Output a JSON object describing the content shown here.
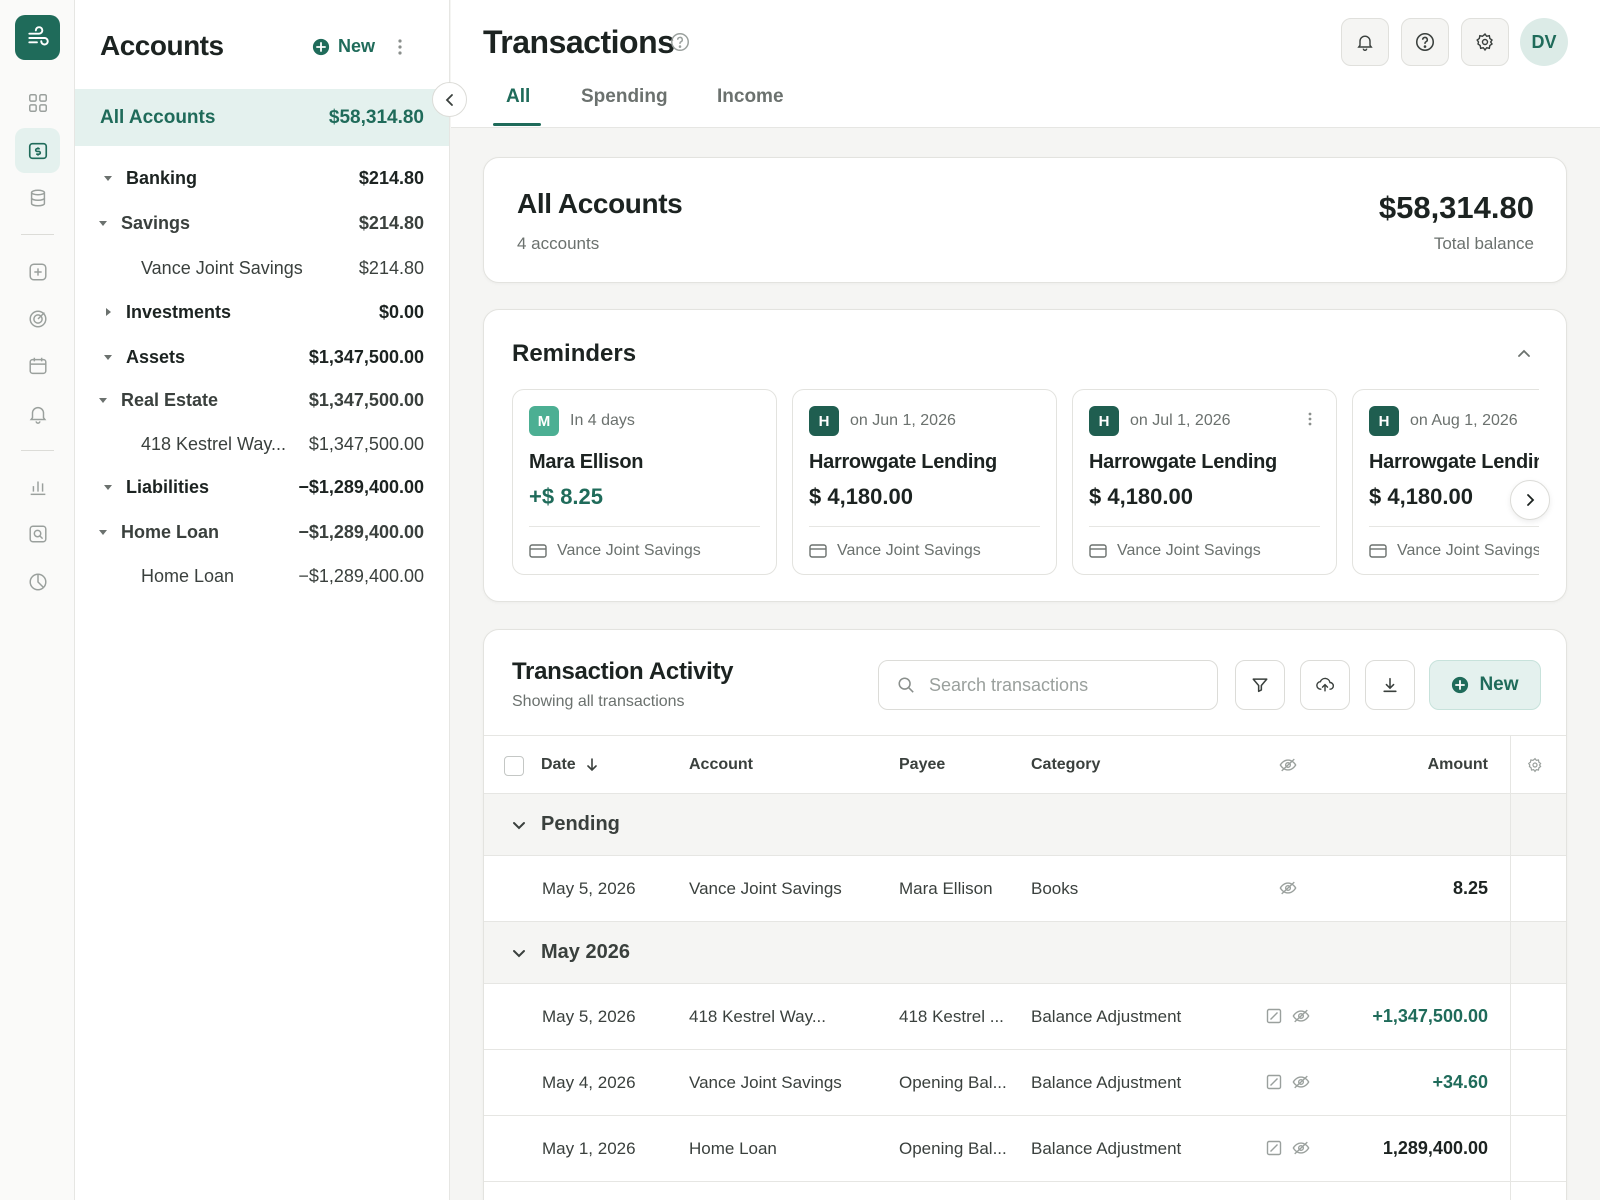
{
  "colors": {
    "accent": "#1f6b5a",
    "accent_light": "#e4f1ee",
    "badge_m": "#4caf93",
    "badge_h": "#1f5e50"
  },
  "rail": {
    "icons": [
      "logo-icon",
      "dashboard-icon",
      "transactions-icon",
      "database-icon",
      "add-icon",
      "target-icon",
      "calendar-icon",
      "bell-icon",
      "bar-chart-icon",
      "receipt-search-icon",
      "pie-chart-icon"
    ]
  },
  "accounts": {
    "title": "Accounts",
    "new_label": "New",
    "all": {
      "label": "All Accounts",
      "value": "$58,314.80"
    },
    "tree": [
      {
        "name": "Banking",
        "value": "$214.80"
      },
      {
        "name": "Savings",
        "value": "$214.80"
      },
      {
        "name": "Vance Joint Savings",
        "value": "$214.80"
      },
      {
        "name": "Investments",
        "value": "$0.00"
      },
      {
        "name": "Assets",
        "value": "$1,347,500.00"
      },
      {
        "name": "Real Estate",
        "value": "$1,347,500.00"
      },
      {
        "name": "418 Kestrel Way...",
        "value": "$1,347,500.00"
      },
      {
        "name": "Liabilities",
        "value": "−$1,289,400.00"
      },
      {
        "name": "Home Loan",
        "value": "−$1,289,400.00"
      },
      {
        "name": "Home Loan",
        "value": "−$1,289,400.00"
      }
    ]
  },
  "header": {
    "title": "Transactions",
    "avatar": "DV",
    "tabs": [
      {
        "label": "All"
      },
      {
        "label": "Spending"
      },
      {
        "label": "Income"
      }
    ]
  },
  "summary": {
    "title": "All Accounts",
    "subtitle": "4 accounts",
    "balance": "$58,314.80",
    "balance_label": "Total balance"
  },
  "reminders": {
    "title": "Reminders",
    "cards": [
      {
        "badge": "M",
        "when": "In 4 days",
        "payee": "Mara Ellison",
        "amount": "+$ 8.25",
        "account": "Vance Joint Savings"
      },
      {
        "badge": "H",
        "when": "on Jun 1, 2026",
        "payee": "Harrowgate Lending",
        "amount": "$ 4,180.00",
        "account": "Vance Joint Savings"
      },
      {
        "badge": "H",
        "when": "on Jul 1, 2026",
        "payee": "Harrowgate Lending",
        "amount": "$ 4,180.00",
        "account": "Vance Joint Savings"
      },
      {
        "badge": "H",
        "when": "on Aug 1, 2026",
        "payee": "Harrowgate Lending",
        "amount": "$ 4,180.00",
        "account": "Vance Joint Savings"
      }
    ]
  },
  "activity": {
    "title": "Transaction Activity",
    "subtitle": "Showing all transactions",
    "search_placeholder": "Search transactions",
    "new_label": "New",
    "columns": {
      "date": "Date",
      "account": "Account",
      "payee": "Payee",
      "category": "Category",
      "amount": "Amount"
    },
    "groups": [
      {
        "label": "Pending",
        "rows": [
          {
            "date": "May 5, 2026",
            "account": "Vance Joint Savings",
            "payee": "Mara Ellison",
            "category": "Books",
            "amount": "8.25"
          }
        ]
      },
      {
        "label": "May 2026",
        "rows": [
          {
            "date": "May 5, 2026",
            "account": "418 Kestrel Way...",
            "payee": "418 Kestrel ...",
            "category": "Balance Adjustment",
            "amount": "+1,347,500.00"
          },
          {
            "date": "May 4, 2026",
            "account": "Vance Joint Savings",
            "payee": "Opening Bal...",
            "category": "Balance Adjustment",
            "amount": "+34.60"
          },
          {
            "date": "May 1, 2026",
            "account": "Home Loan",
            "payee": "Opening Bal...",
            "category": "Balance Adjustment",
            "amount": "1,289,400.00"
          }
        ]
      }
    ]
  }
}
